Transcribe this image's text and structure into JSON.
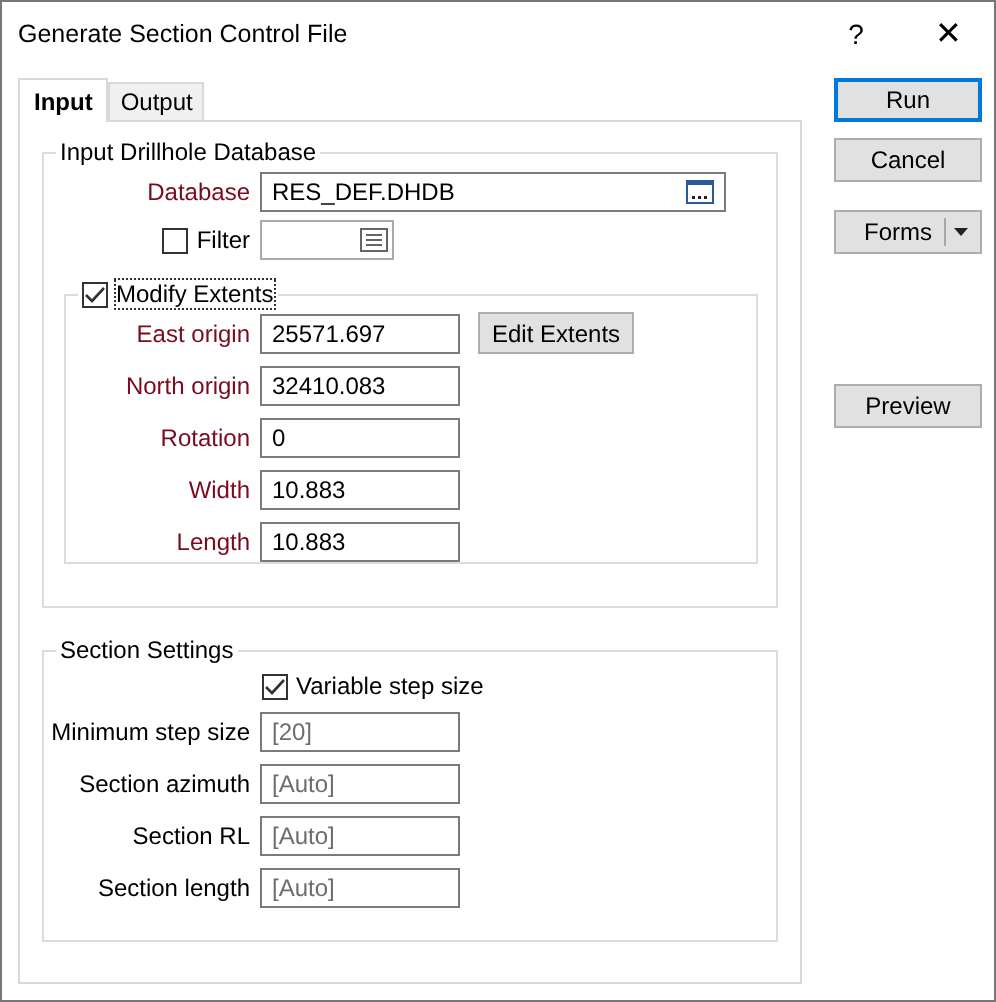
{
  "window": {
    "title": "Generate Section Control File",
    "help": "?",
    "close": "✕"
  },
  "tabs": [
    {
      "label": "Input",
      "selected": true
    },
    {
      "label": "Output",
      "selected": false
    }
  ],
  "input_group": {
    "title": "Input Drillhole Database",
    "database": {
      "label": "Database",
      "value": "RES_DEF.DHDB",
      "required": true
    },
    "filter": {
      "label": "Filter",
      "checked": false
    },
    "modify_extents": {
      "label": "Modify Extents",
      "checked": true,
      "focused": true,
      "fields": [
        {
          "label": "East origin",
          "value": "25571.697",
          "required": true
        },
        {
          "label": "North origin",
          "value": "32410.083",
          "required": true
        },
        {
          "label": "Rotation",
          "value": "0",
          "required": true
        },
        {
          "label": "Width",
          "value": "10.883",
          "required": true
        },
        {
          "label": "Length",
          "value": "10.883",
          "required": true
        }
      ],
      "edit_button": "Edit Extents"
    }
  },
  "section_group": {
    "title": "Section Settings",
    "variable_step": {
      "label": "Variable step size",
      "checked": true
    },
    "fields": [
      {
        "label": "Minimum step size",
        "placeholder": "[20]",
        "required": false
      },
      {
        "label": "Section azimuth",
        "placeholder": "[Auto]",
        "required": false
      },
      {
        "label": "Section RL",
        "placeholder": "[Auto]",
        "required": false
      },
      {
        "label": "Section length",
        "placeholder": "[Auto]",
        "required": false
      }
    ]
  },
  "buttons": {
    "run": "Run",
    "cancel": "Cancel",
    "forms": "Forms",
    "preview": "Preview"
  }
}
